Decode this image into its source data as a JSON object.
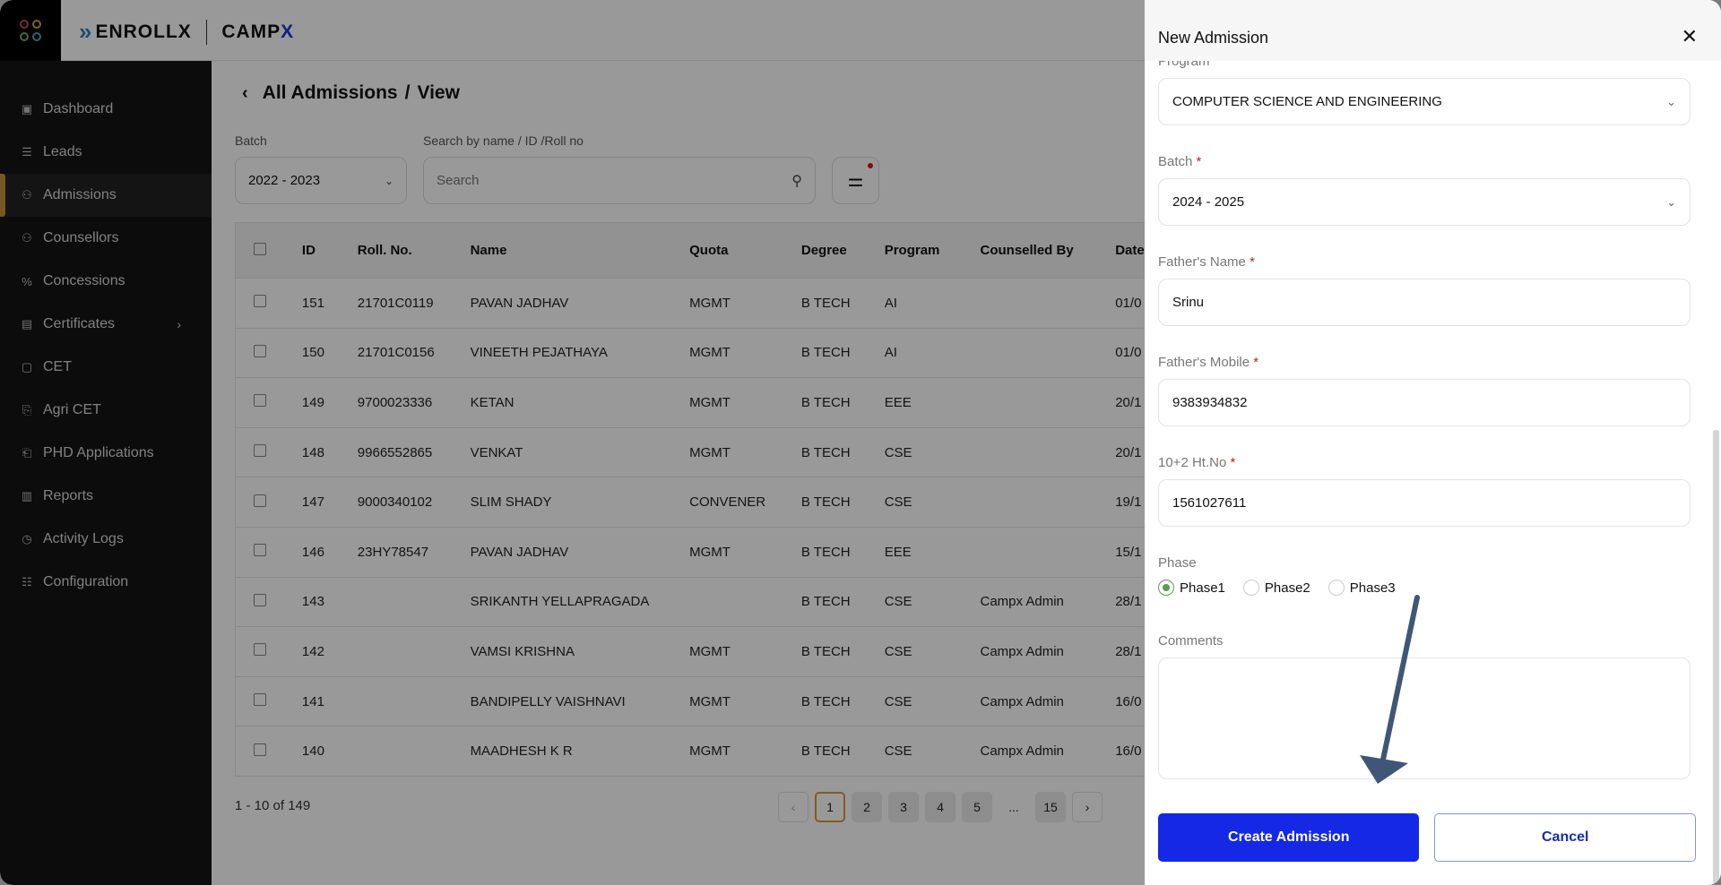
{
  "brand": {
    "product": "ENROLLX",
    "company_prefix": "CAMP",
    "company_suffix": "X",
    "accent": "#2a2fd8"
  },
  "sidebar": {
    "items": [
      {
        "label": "Dashboard",
        "icon": "dashboard-grid-icon"
      },
      {
        "label": "Leads",
        "icon": "checklist-icon"
      },
      {
        "label": "Admissions",
        "icon": "users-icon",
        "active": true
      },
      {
        "label": "Counsellors",
        "icon": "users-icon"
      },
      {
        "label": "Concessions",
        "icon": "percent-icon"
      },
      {
        "label": "Certificates",
        "icon": "calendar-icon",
        "has_children": true
      },
      {
        "label": "CET",
        "icon": "square-icon"
      },
      {
        "label": "Agri CET",
        "icon": "document-icon"
      },
      {
        "label": "PHD Applications",
        "icon": "document-badge-icon"
      },
      {
        "label": "Reports",
        "icon": "bar-chart-icon"
      },
      {
        "label": "Activity Logs",
        "icon": "clock-icon"
      },
      {
        "label": "Configuration",
        "icon": "sliders-icon"
      }
    ],
    "active_color": "#c4933a"
  },
  "main": {
    "breadcrumb": {
      "parent": "All Admissions",
      "separator": "/",
      "current": "View"
    },
    "filters": {
      "batch_label": "Batch",
      "batch_value": "2022 - 2023",
      "search_label": "Search by name / ID /Roll no",
      "search_placeholder": "Search"
    },
    "table": {
      "columns": [
        "ID",
        "Roll. No.",
        "Name",
        "Quota",
        "Degree",
        "Program",
        "Counselled By",
        "Date"
      ],
      "rows": [
        {
          "id": "151",
          "roll": "21701C0119",
          "name": "PAVAN JADHAV",
          "quota": "MGMT",
          "degree": "B TECH",
          "program": "AI",
          "counselled_by": "",
          "date": "01/0"
        },
        {
          "id": "150",
          "roll": "21701C0156",
          "name": "VINEETH PEJATHAYA",
          "quota": "MGMT",
          "degree": "B TECH",
          "program": "AI",
          "counselled_by": "",
          "date": "01/0"
        },
        {
          "id": "149",
          "roll": "9700023336",
          "name": "KETAN",
          "quota": "MGMT",
          "degree": "B TECH",
          "program": "EEE",
          "counselled_by": "",
          "date": "20/1"
        },
        {
          "id": "148",
          "roll": "9966552865",
          "name": "VENKAT",
          "quota": "MGMT",
          "degree": "B TECH",
          "program": "CSE",
          "counselled_by": "",
          "date": "20/1"
        },
        {
          "id": "147",
          "roll": "9000340102",
          "name": "SLIM SHADY",
          "quota": "CONVENER",
          "degree": "B TECH",
          "program": "CSE",
          "counselled_by": "",
          "date": "19/1"
        },
        {
          "id": "146",
          "roll": "23HY78547",
          "name": "PAVAN JADHAV",
          "quota": "MGMT",
          "degree": "B TECH",
          "program": "EEE",
          "counselled_by": "",
          "date": "15/1"
        },
        {
          "id": "143",
          "roll": "",
          "name": "SRIKANTH YELLAPRAGADA",
          "quota": "",
          "degree": "B TECH",
          "program": "CSE",
          "counselled_by": "Campx Admin",
          "date": "28/1"
        },
        {
          "id": "142",
          "roll": "",
          "name": "VAMSI KRISHNA",
          "quota": "MGMT",
          "degree": "B TECH",
          "program": "CSE",
          "counselled_by": "Campx Admin",
          "date": "28/1"
        },
        {
          "id": "141",
          "roll": "",
          "name": "BANDIPELLY VAISHNAVI",
          "quota": "MGMT",
          "degree": "B TECH",
          "program": "CSE",
          "counselled_by": "Campx Admin",
          "date": "16/0"
        },
        {
          "id": "140",
          "roll": "",
          "name": "MAADHESH K R",
          "quota": "MGMT",
          "degree": "B TECH",
          "program": "CSE",
          "counselled_by": "Campx Admin",
          "date": "16/0"
        }
      ]
    },
    "pagination": {
      "summary": "1 - 10 of 149",
      "pages": [
        "1",
        "2",
        "3",
        "4",
        "5",
        "...",
        "15"
      ],
      "current": "1",
      "prev": "‹",
      "next": "›",
      "active_color": "#d79a3a"
    }
  },
  "drawer": {
    "title": "New Admission",
    "close": "✕",
    "fields": {
      "program": {
        "label": "Program",
        "value": "COMPUTER SCIENCE AND ENGINEERING",
        "required": true
      },
      "batch": {
        "label": "Batch",
        "value": "2024 - 2025",
        "required": true
      },
      "father_name": {
        "label": "Father's Name",
        "value": "Srinu",
        "required": true
      },
      "father_mobile": {
        "label": "Father's Mobile",
        "value": "9383934832",
        "required": true
      },
      "ht_no": {
        "label": "10+2 Ht.No",
        "value": "1561027611",
        "required": true
      },
      "phase": {
        "label": "Phase",
        "options": [
          "Phase1",
          "Phase2",
          "Phase3"
        ],
        "selected": "Phase1"
      },
      "comments": {
        "label": "Comments",
        "value": ""
      }
    },
    "required_marker": "*",
    "buttons": {
      "create": "Create Admission",
      "cancel": "Cancel"
    },
    "primary_color": "#1428e6"
  },
  "annotation": {
    "type": "arrow",
    "points_to": "create-admission-button",
    "color": "#3f5677"
  }
}
